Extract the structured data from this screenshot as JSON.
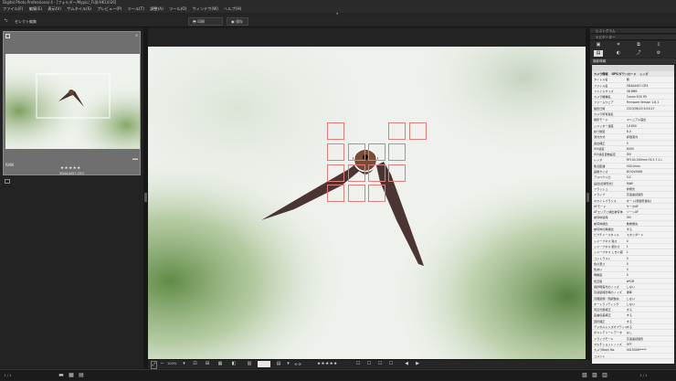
{
  "app": {
    "title": "Digital Photo Professional 4 - [フォルダー/Mypic/_FUJI/HK1/026]"
  },
  "menu": [
    "ファイル(F)",
    "編集(E)",
    "表示(V)",
    "サムネイル(S)",
    "プレビュー(P)",
    "ツール(T)",
    "調整(A)",
    "ツール(O)",
    "ウィンドウ(W)",
    "ヘルプ(H)"
  ],
  "toolbar": {
    "back_label": "",
    "mode_label": "セレクト編集",
    "print_label": "印刷",
    "save_label": "保存"
  },
  "thumbnail": {
    "filename": "5D4A4457.CR3",
    "rating": "★★★★★",
    "badge": "RAW"
  },
  "right_panel": {
    "headers": [
      "ヒストグラム",
      "ナビゲーター"
    ],
    "section_title": "撮影情報",
    "tab_labels": [
      "カメラ情報",
      "GPS/ダウンロード",
      "レンズ"
    ]
  },
  "info_rows": [
    [
      "タイトル名",
      "無"
    ],
    [
      "ファイル名",
      "5D4A4457.CR3"
    ],
    [
      "ファイルサイズ",
      "38.8MB"
    ],
    [
      "カメラ機種名",
      "Canon EOS R5"
    ],
    [
      "ファームウェア",
      "Firmware Version 1.8.1"
    ],
    [
      "撮影日時",
      "2023/06/20 8:53:27"
    ],
    [
      "カメラ所有者名",
      ""
    ],
    [
      "撮影モード",
      "マニュアル露出"
    ],
    [
      "シャッター速度",
      "1/1600"
    ],
    [
      "絞り数値",
      "8.0"
    ],
    [
      "測光方式",
      "評価測光"
    ],
    [
      "露出補正",
      "0"
    ],
    [
      "ISO感度",
      "6400"
    ],
    [
      "ISO感度自動設定",
      "ON"
    ],
    [
      "レンズ",
      "RF100-500mm F4.5-7.1 L"
    ],
    [
      "焦点距離",
      "500.0mm"
    ],
    [
      "画像サイズ",
      "8192x5464"
    ],
    [
      "アスペクト比",
      "3:2"
    ],
    [
      "画質(記録形式)",
      "RAW"
    ],
    [
      "フラッシュ",
      "非発光"
    ],
    [
      "ドライブ",
      "高速連続撮影"
    ],
    [
      "ホワイトバランス",
      "オート(雰囲気優先)"
    ],
    [
      "AFモード",
      "サーボAF"
    ],
    [
      "AFエリアと検出被写体",
      "ゾーンAF"
    ],
    [
      "被写体追尾",
      "ON"
    ],
    [
      "被写体検出",
      "動物優先"
    ],
    [
      "被写体の瞳検出",
      "する"
    ],
    [
      "ピクチャースタイル",
      "スタンダード"
    ],
    [
      "シャープネス 強さ",
      "4"
    ],
    [
      "シャープネス 細かさ",
      "1"
    ],
    [
      "シャープネス しきい値",
      "1"
    ],
    [
      "コントラスト",
      "0"
    ],
    [
      "色の濃さ",
      "0"
    ],
    [
      "色あい",
      "0"
    ],
    [
      "明瞭度",
      "0"
    ],
    [
      "色空間",
      "sRGB"
    ],
    [
      "長秒時露光のノイズ",
      "しない"
    ],
    [
      "高感度撮影時のノイズ",
      "標準"
    ],
    [
      "高輝度側・階調優先",
      "しない"
    ],
    [
      "オートライティング",
      "しない"
    ],
    [
      "周辺光量補正",
      "する"
    ],
    [
      "歪曲収差補正",
      "する"
    ],
    [
      "回折補正",
      "する"
    ],
    [
      "デジタルレンズオプティマイザ",
      "する"
    ],
    [
      "ダストデリートデータ",
      "なし"
    ],
    [
      "ドライブモード",
      "高速連続撮影"
    ],
    [
      "マルチショットノイズ",
      "OFF"
    ],
    [
      "カメラBody No.",
      "0415048*****"
    ],
    [
      "コメント",
      ""
    ]
  ],
  "viewer_bottom": {
    "zoom_label": "100%",
    "rating": "★★★★★",
    "page_info": "1/1"
  },
  "status": {
    "left": "1 / 1",
    "right": "1 / 1"
  }
}
